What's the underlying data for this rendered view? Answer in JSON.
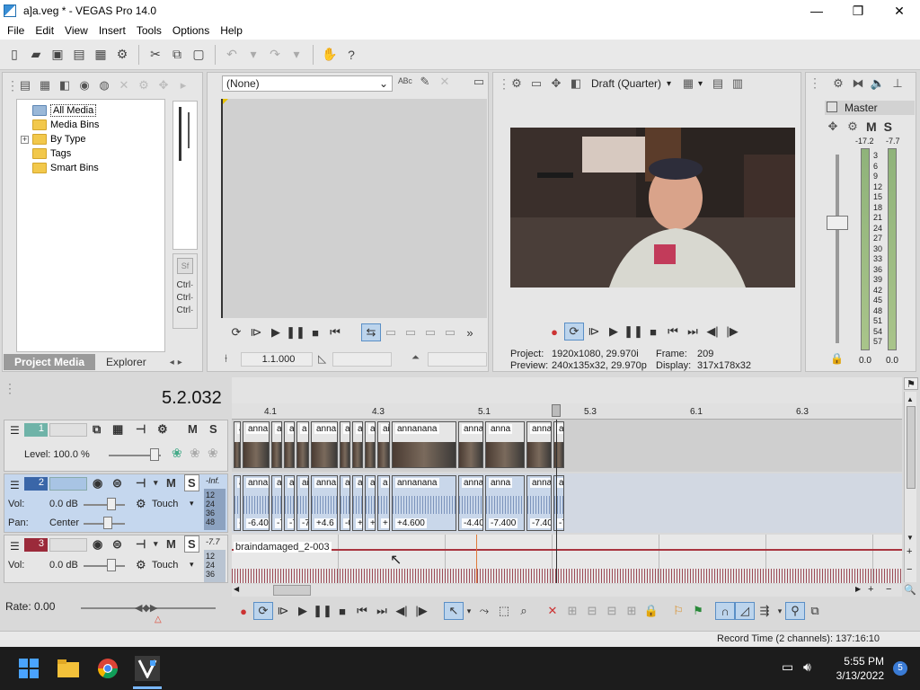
{
  "window": {
    "title": "a]a.veg * - VEGAS Pro 14.0",
    "minimize": "—",
    "maximize": "❐",
    "close": "✕"
  },
  "menu": [
    "File",
    "Edit",
    "View",
    "Insert",
    "Tools",
    "Options",
    "Help"
  ],
  "project_media": {
    "items": [
      {
        "label": "All Media",
        "expand": ""
      },
      {
        "label": "Media Bins",
        "expand": ""
      },
      {
        "label": "By Type",
        "expand": "+"
      },
      {
        "label": "Tags",
        "expand": ""
      },
      {
        "label": "Smart Bins",
        "expand": ""
      }
    ],
    "tabs": [
      "Project Media",
      "Explorer"
    ],
    "ctrl_labels": [
      "Ctrl·",
      "Ctrl·",
      "Ctrl·"
    ]
  },
  "trimmer": {
    "selection": "(None)",
    "time": "1.1.000"
  },
  "preview": {
    "quality": "Draft (Quarter)",
    "project_label": "Project:",
    "project_value": "1920x1080, 29.970i",
    "preview_label": "Preview:",
    "preview_value": "240x135x32, 29.970p",
    "frame_label": "Frame:",
    "frame_value": "209",
    "display_label": "Display:",
    "display_value": "317x178x32"
  },
  "master": {
    "title": "Master",
    "m_label": "M",
    "s_label": "S",
    "peak_left": "-17.2",
    "peak_right": "-7.7",
    "scale": [
      "3",
      "6",
      "9",
      "12",
      "15",
      "18",
      "21",
      "24",
      "27",
      "30",
      "33",
      "36",
      "39",
      "42",
      "45",
      "48",
      "51",
      "54",
      "57"
    ],
    "level_left": "0.0",
    "level_right": "0.0"
  },
  "timeline": {
    "timecode": "5.2.032",
    "ruler": [
      "4.1",
      "4.3",
      "5.1",
      "5.3",
      "6.1",
      "6.3"
    ],
    "tracks": [
      {
        "number": "1",
        "level": "Level: 100.0 %",
        "m": "M",
        "s": "S"
      },
      {
        "number": "2",
        "vol_label": "Vol:",
        "vol": "0.0 dB",
        "pan_label": "Pan:",
        "pan": "Center",
        "mode": "Touch",
        "m": "M",
        "s": "S",
        "peak": "-Inf."
      },
      {
        "number": "3",
        "vol_label": "Vol:",
        "vol": "0.0 dB",
        "mode": "Touch",
        "m": "M",
        "s": "S",
        "peak": "-7.7"
      }
    ],
    "meter_scale": [
      "12",
      "24",
      "36",
      "48"
    ],
    "video_events": [
      "a",
      "anna",
      "a",
      "a",
      "a",
      "anna",
      "a",
      "a",
      "a",
      "ai",
      "annanana",
      "anna",
      "anna",
      "anna",
      "ai"
    ],
    "audio_events": [
      {
        "title": "a",
        "gain": "-"
      },
      {
        "title": "anna",
        "gain": "-6.40"
      },
      {
        "title": "a",
        "gain": "-7"
      },
      {
        "title": "a",
        "gain": "-7"
      },
      {
        "title": "ai",
        "gain": "-7"
      },
      {
        "title": "anna",
        "gain": "+4.6"
      },
      {
        "title": "a",
        "gain": "-0"
      },
      {
        "title": "a",
        "gain": "+"
      },
      {
        "title": "a",
        "gain": "+"
      },
      {
        "title": "a",
        "gain": "+"
      },
      {
        "title": "annanana",
        "gain": "+4.600"
      },
      {
        "title": "anna",
        "gain": "-4.40"
      },
      {
        "title": "anna",
        "gain": "-7.400"
      },
      {
        "title": "anna",
        "gain": "-7.40"
      },
      {
        "title": "a",
        "gain": "-7"
      }
    ],
    "audio3_event": "braindamaged_2-003",
    "rate": "Rate: 0.00"
  },
  "status": {
    "record_time": "Record Time (2 channels): 137:16:10"
  },
  "taskbar": {
    "time": "5:55 PM",
    "date": "3/13/2022",
    "notifications": "5"
  }
}
